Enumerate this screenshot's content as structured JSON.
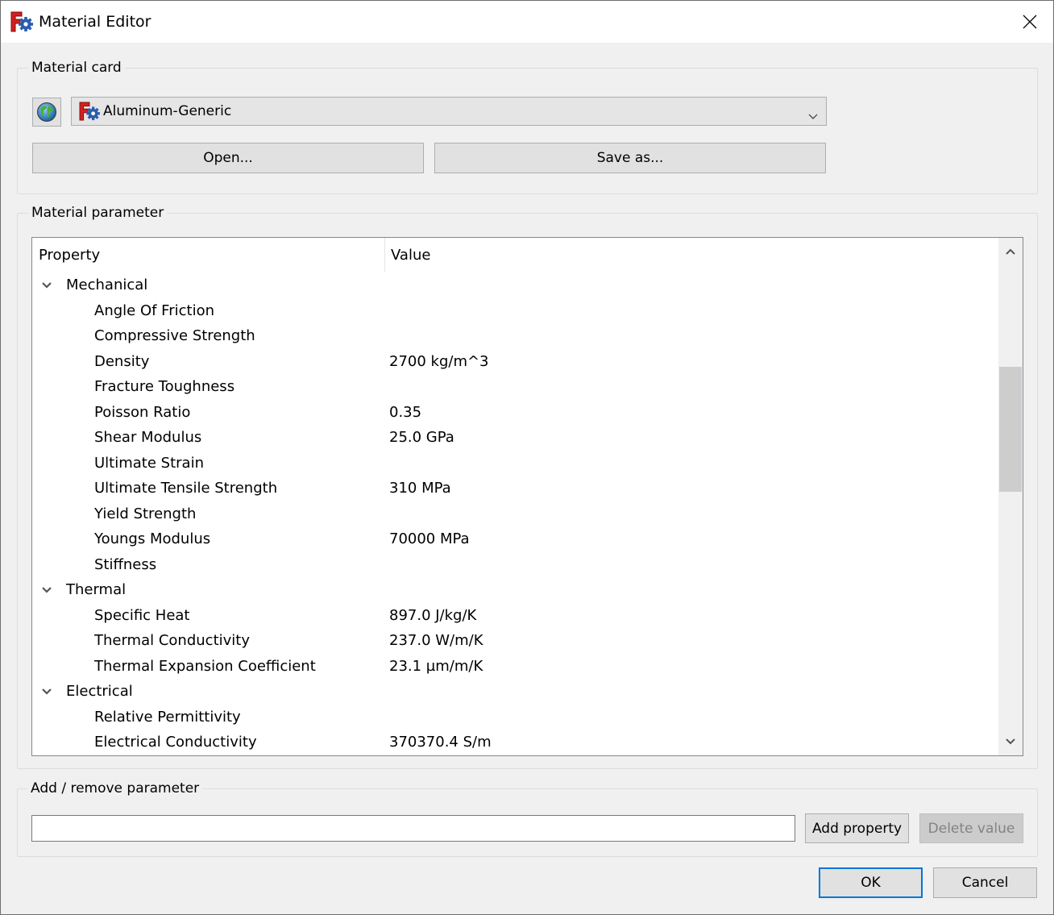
{
  "window": {
    "title": "Material Editor",
    "close_icon": "close-icon"
  },
  "material_card": {
    "group_title": "Material card",
    "selected_card": "Aluminum-Generic",
    "open_label": "Open...",
    "save_as_label": "Save as...",
    "globe_icon": "globe-icon",
    "dropdown_icon": "chevron-down-icon"
  },
  "material_parameter": {
    "group_title": "Material parameter",
    "columns": {
      "property": "Property",
      "value": "Value"
    },
    "scroll": {
      "position_fraction": 0.22,
      "visible_fraction": 0.27
    },
    "groups": [
      {
        "name": "Mechanical",
        "expanded": true,
        "rows": [
          {
            "property": "Angle Of Friction",
            "value": ""
          },
          {
            "property": "Compressive Strength",
            "value": ""
          },
          {
            "property": "Density",
            "value": "2700 kg/m^3"
          },
          {
            "property": "Fracture Toughness",
            "value": ""
          },
          {
            "property": "Poisson Ratio",
            "value": "0.35"
          },
          {
            "property": "Shear Modulus",
            "value": "25.0 GPa"
          },
          {
            "property": "Ultimate Strain",
            "value": ""
          },
          {
            "property": "Ultimate Tensile Strength",
            "value": "310 MPa"
          },
          {
            "property": "Yield Strength",
            "value": ""
          },
          {
            "property": "Youngs Modulus",
            "value": "70000 MPa"
          },
          {
            "property": "Stiffness",
            "value": ""
          }
        ]
      },
      {
        "name": "Thermal",
        "expanded": true,
        "rows": [
          {
            "property": "Specific Heat",
            "value": "897.0 J/kg/K"
          },
          {
            "property": "Thermal Conductivity",
            "value": "237.0 W/m/K"
          },
          {
            "property": "Thermal Expansion Coefficient",
            "value": "23.1 µm/m/K"
          }
        ]
      },
      {
        "name": "Electrical",
        "expanded": true,
        "rows": [
          {
            "property": "Relative Permittivity",
            "value": ""
          },
          {
            "property": "Electrical Conductivity",
            "value": "370370.4 S/m"
          }
        ]
      }
    ]
  },
  "add_remove": {
    "group_title": "Add / remove parameter",
    "input_value": "",
    "add_label": "Add property",
    "delete_label": "Delete value"
  },
  "footer": {
    "ok_label": "OK",
    "cancel_label": "Cancel"
  },
  "colors": {
    "focus_accent": "#0078d7",
    "freecad_red": "#d42020",
    "freecad_blue": "#2a5db0"
  }
}
